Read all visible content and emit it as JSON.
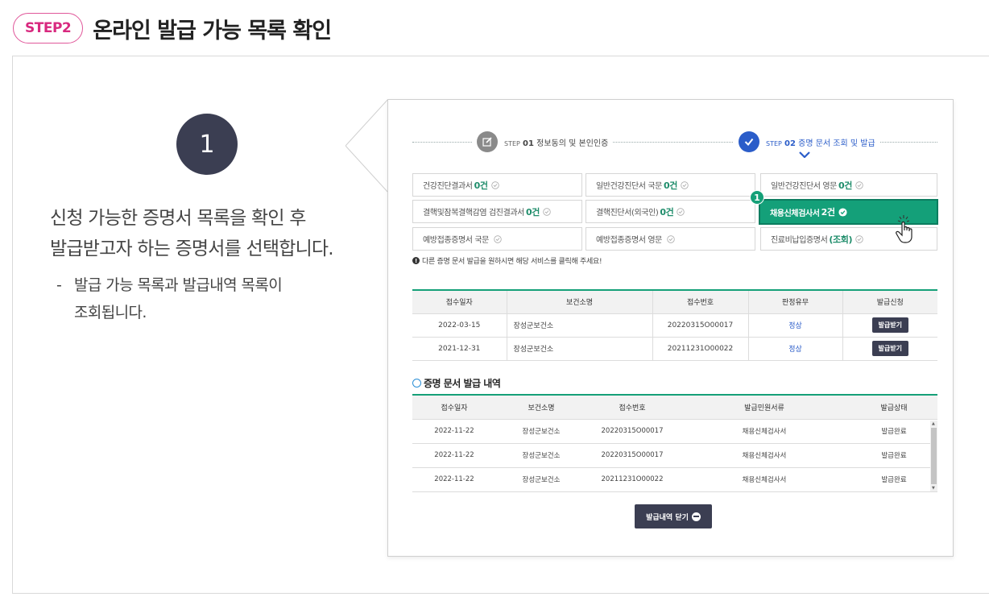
{
  "header": {
    "step_label": "STEP2",
    "title": "온라인 발급 가능 목록 확인"
  },
  "left": {
    "step_number": "1",
    "desc_line1": "신청 가능한 증명서 목록을 확인 후",
    "desc_line2": "발급받고자 하는 증명서를 선택합니다.",
    "sub_dash": "-",
    "sub_line1": "발급 가능 목록과 발급내역 목록이",
    "sub_line2": "조회됩니다."
  },
  "steps": [
    {
      "prefix": "STEP",
      "num": "01",
      "label": "정보동의 및 본인인증",
      "icon": "edit-icon"
    },
    {
      "prefix": "STEP",
      "num": "02",
      "label": "증명 문서 조회 및 발급",
      "icon": "check-icon",
      "active": true
    }
  ],
  "certs": [
    {
      "name": "건강진단결과서",
      "count": "0건"
    },
    {
      "name": "일반건강진단서 국문",
      "count": "0건"
    },
    {
      "name": "일반건강진단서 영문",
      "count": "0건"
    },
    {
      "name": "결핵및잠복결핵감염 검진결과서",
      "count": "0건"
    },
    {
      "name": "결핵진단서(외국인)",
      "count": "0건"
    },
    {
      "name": "채용신체검사서",
      "count": "2건"
    },
    {
      "name": "예방접종증명서 국문",
      "count": ""
    },
    {
      "name": "예방접종증명서 영문",
      "count": ""
    },
    {
      "name": "진료비납입증명서",
      "count": "(조회)"
    }
  ],
  "selected_badge": "1",
  "note": "다른 증명 문서 발급을 원하시면 해당 서비스를 클릭해 주세요!",
  "note_icon": "!",
  "issue_table": {
    "headers": [
      "접수일자",
      "보건소명",
      "접수번호",
      "판정유무",
      "발급신청"
    ],
    "rows": [
      {
        "date": "2022-03-15",
        "center": "장성군보건소",
        "no": "20220315O00017",
        "result": "정상",
        "action": "발급받기"
      },
      {
        "date": "2021-12-31",
        "center": "장성군보건소",
        "no": "20211231O00022",
        "result": "정상",
        "action": "발급받기"
      }
    ]
  },
  "history": {
    "title": "증명 문서 발급 내역",
    "headers": [
      "접수일자",
      "보건소명",
      "접수번호",
      "발급민원서류",
      "발급상태"
    ],
    "rows": [
      {
        "date": "2022-11-22",
        "center": "장성군보건소",
        "no": "20220315O00017",
        "doc": "채용신체검사서",
        "status": "발급완료"
      },
      {
        "date": "2022-11-22",
        "center": "장성군보건소",
        "no": "20220315O00017",
        "doc": "채용신체검사서",
        "status": "발급완료"
      },
      {
        "date": "2022-11-22",
        "center": "장성군보건소",
        "no": "20211231O00022",
        "doc": "채용신체검사서",
        "status": "발급완료"
      }
    ]
  },
  "close_button": "발급내역 닫기",
  "colors": {
    "accent_pink": "#d8297f",
    "accent_green": "#15a078",
    "navy": "#3b3e52",
    "blue": "#2b5dc9"
  }
}
